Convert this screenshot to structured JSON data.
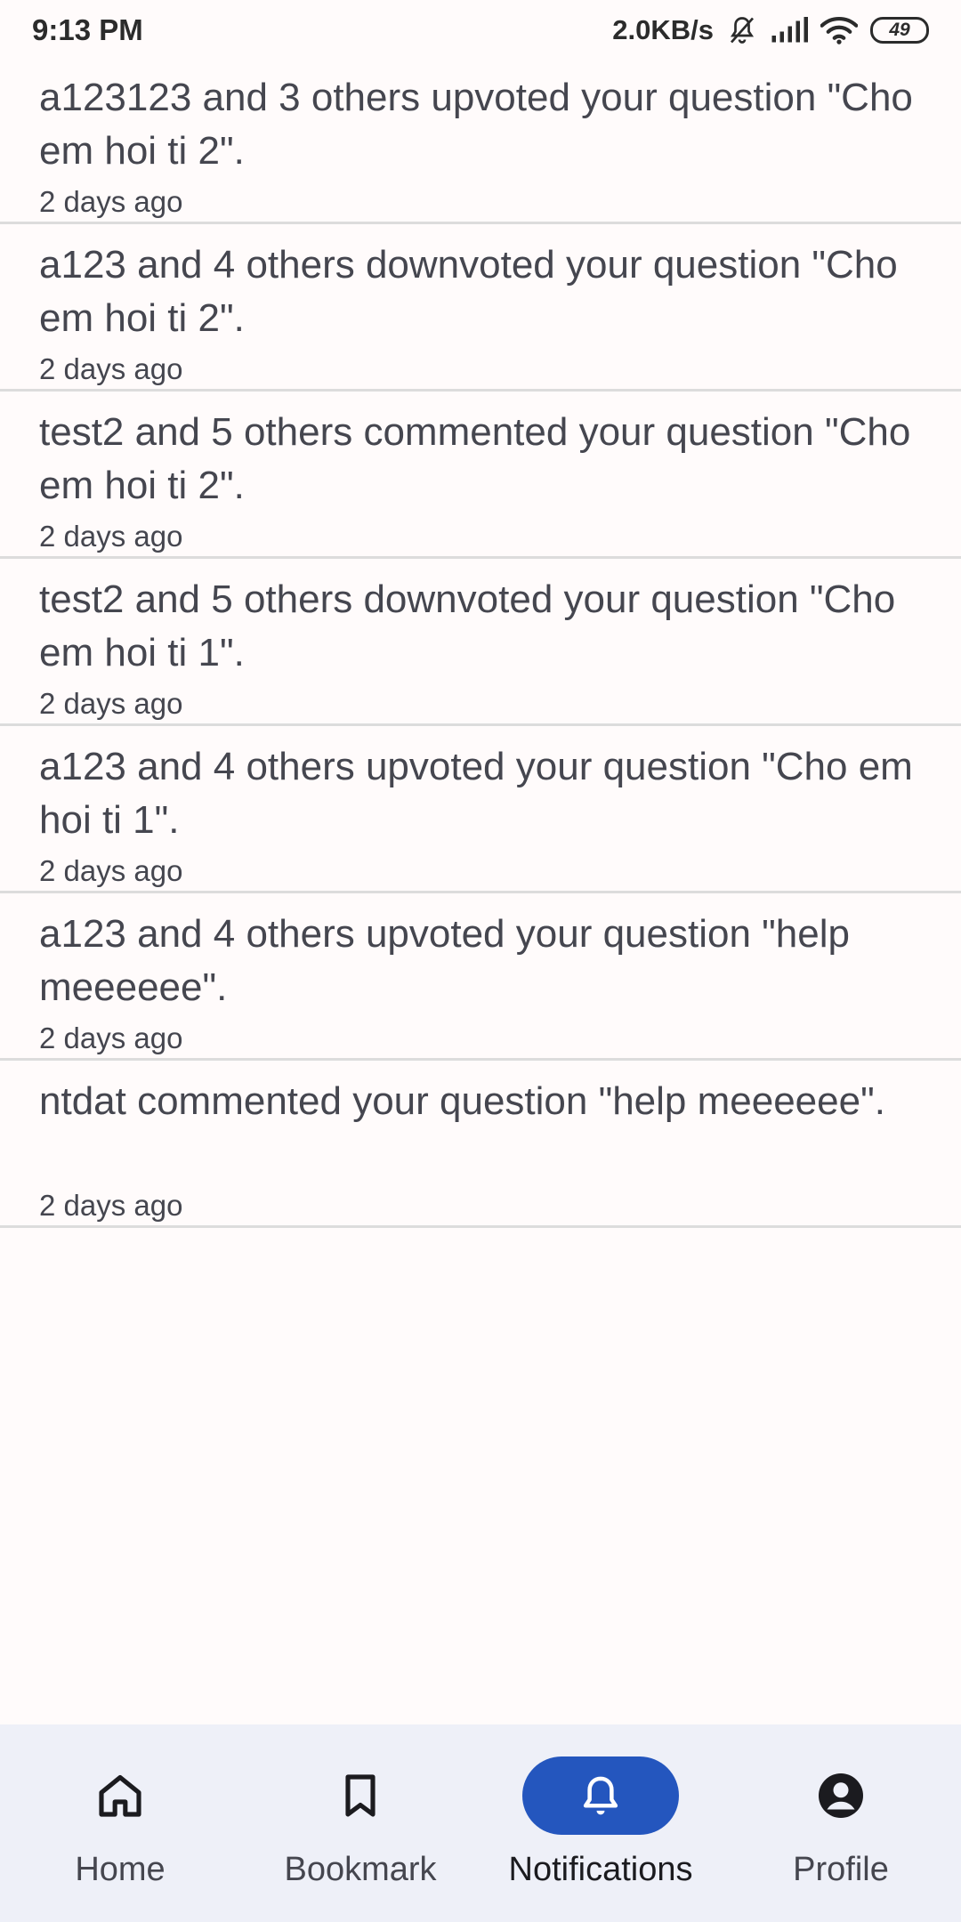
{
  "status_bar": {
    "time": "9:13 PM",
    "net_speed": "2.0KB/s",
    "battery": "49"
  },
  "notifications": [
    {
      "text": "a123123 and 3 others upvoted your question \"Cho em hoi ti 2\".",
      "time": "2 days ago"
    },
    {
      "text": "a123 and 4 others downvoted your question \"Cho em hoi ti 2\".",
      "time": "2 days ago"
    },
    {
      "text": "test2 and 5 others commented your question \"Cho em hoi ti 2\".",
      "time": "2 days ago"
    },
    {
      "text": "test2 and 5 others downvoted your question \"Cho em hoi ti 1\".",
      "time": "2 days ago"
    },
    {
      "text": "a123 and 4 others upvoted your question \"Cho em hoi ti 1\".",
      "time": "2 days ago"
    },
    {
      "text": "a123 and 4 others upvoted your question \"help meeeeee\".",
      "time": "2 days ago"
    },
    {
      "text": "ntdat commented your question \"help meeeeee\".",
      "time": "2 days ago"
    }
  ],
  "bottom_nav": {
    "items": [
      {
        "label": "Home",
        "icon": "home-icon"
      },
      {
        "label": "Bookmark",
        "icon": "bookmark-icon"
      },
      {
        "label": "Notifications",
        "icon": "bell-icon",
        "active": true
      },
      {
        "label": "Profile",
        "icon": "profile-icon"
      }
    ],
    "active_color": "#2456be"
  }
}
